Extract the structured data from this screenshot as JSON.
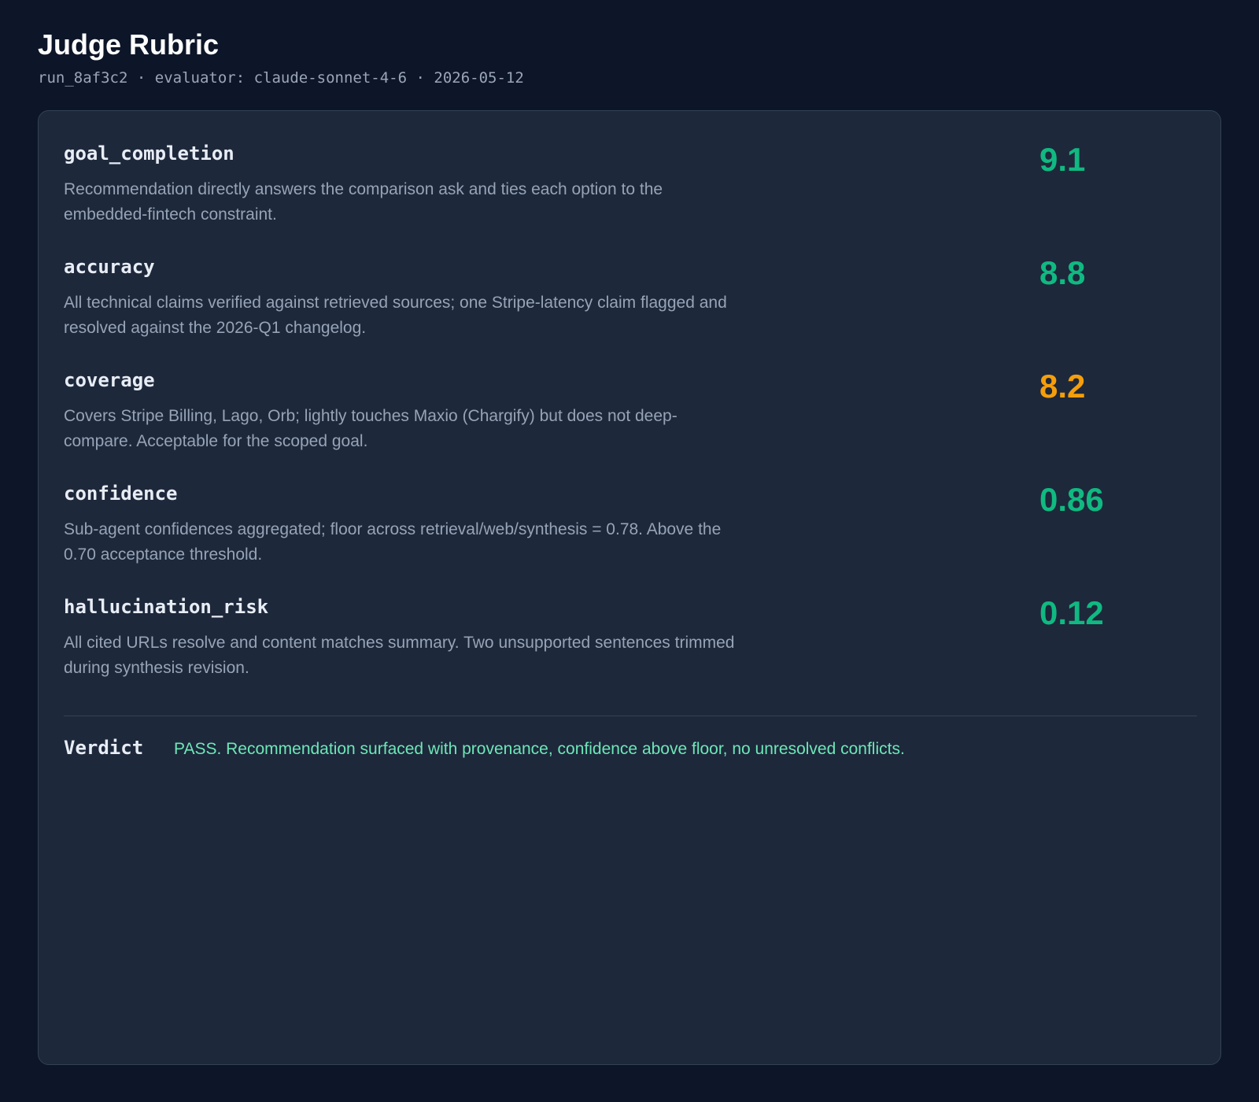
{
  "header": {
    "title": "Judge Rubric",
    "run_id": "run_8af3c2",
    "evaluator": "evaluator: claude-sonnet-4-6",
    "date": "2026-05-12",
    "separator": "·"
  },
  "colors": {
    "good": "#10b981",
    "warn": "#f59e0b",
    "verdict": "#6ee7b7"
  },
  "metrics": [
    {
      "name": "goal_completion",
      "score": "9.1",
      "status": "good",
      "description": "Recommendation directly answers the comparison ask and ties each option to the embedded-fintech constraint."
    },
    {
      "name": "accuracy",
      "score": "8.8",
      "status": "good",
      "description": "All technical claims verified against retrieved sources; one Stripe-latency claim flagged and resolved against the 2026-Q1 changelog."
    },
    {
      "name": "coverage",
      "score": "8.2",
      "status": "warn",
      "description": "Covers Stripe Billing, Lago, Orb; lightly touches Maxio (Chargify) but does not deep-compare. Acceptable for the scoped goal."
    },
    {
      "name": "confidence",
      "score": "0.86",
      "status": "good",
      "description": "Sub-agent confidences aggregated; floor across retrieval/web/synthesis = 0.78. Above the 0.70 acceptance threshold."
    },
    {
      "name": "hallucination_risk",
      "score": "0.12",
      "status": "good",
      "description": "All cited URLs resolve and content matches summary. Two unsupported sentences trimmed during synthesis revision."
    }
  ],
  "verdict": {
    "label": "Verdict",
    "text": "PASS. Recommendation surfaced with provenance, confidence above floor, no unresolved conflicts."
  }
}
